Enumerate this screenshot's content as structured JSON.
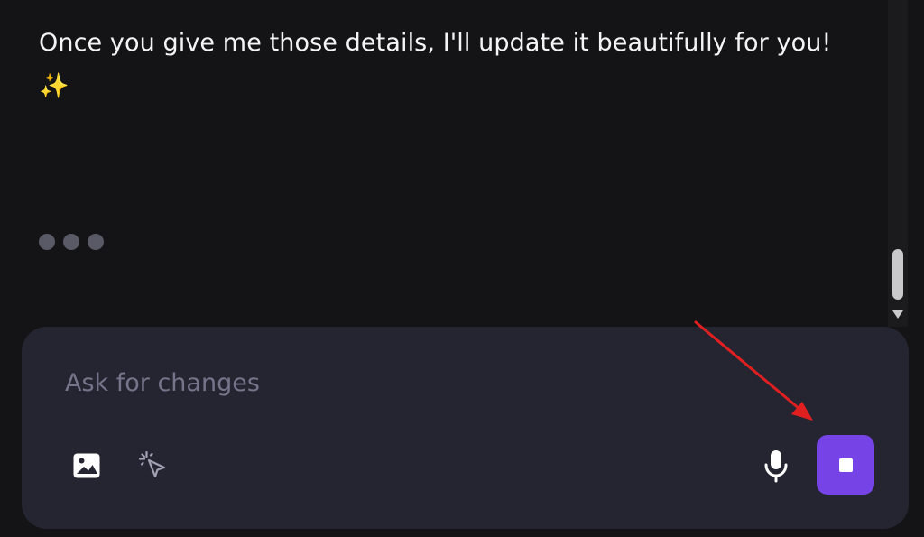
{
  "chat": {
    "message": "Once you give me those details, I'll update it beautifully for you! ✨"
  },
  "composer": {
    "placeholder": "Ask for changes"
  },
  "icons": {
    "image": "image-icon",
    "select": "cursor-sparkle-icon",
    "mic": "microphone-icon",
    "stop": "stop-icon",
    "annotation": "red-arrow-annotation"
  },
  "colors": {
    "background": "#141416",
    "composer": "#252531",
    "accent": "#7644e6",
    "annotation": "#e02020"
  }
}
